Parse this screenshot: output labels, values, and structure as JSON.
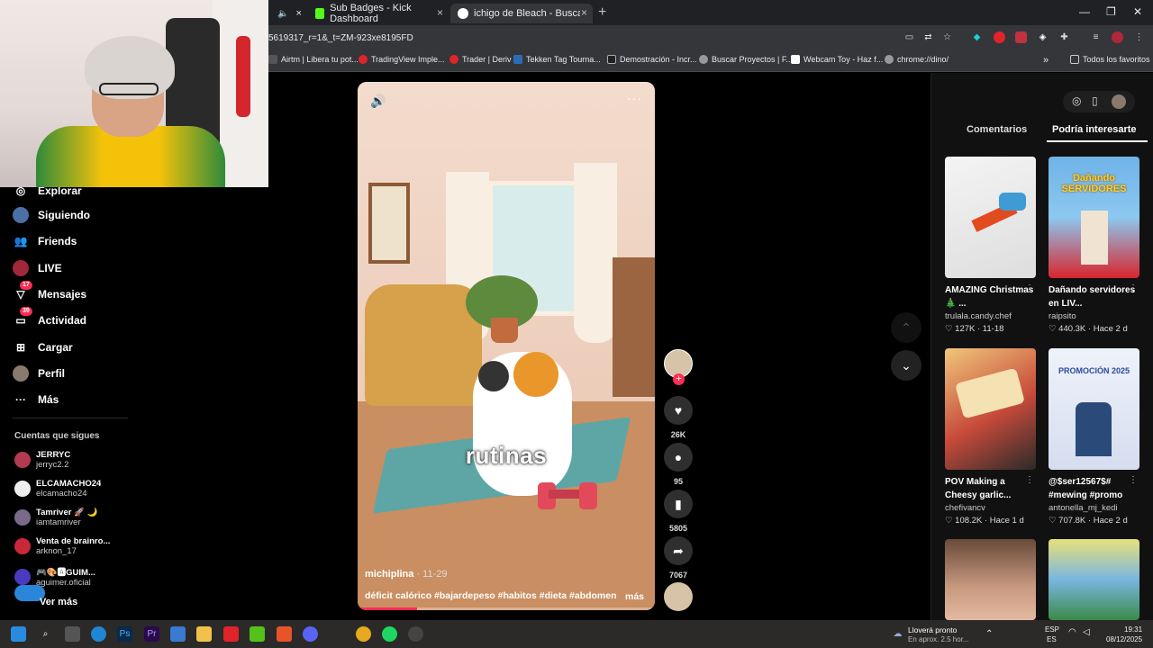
{
  "browser": {
    "tabs": [
      {
        "label": "Sub Badges - Kick Dashboard",
        "close": "×"
      },
      {
        "label": "ichigo de Bleach - Buscar con G",
        "close": "×"
      }
    ],
    "new_tab": "+",
    "first_tab_close": "×",
    "window_controls": [
      "—",
      "❐",
      "✕"
    ],
    "url": "5619317_r=1&_t=ZM-923xe8195FD",
    "bookmarks": [
      "Airtm | Libera tu pot...",
      "TradingView Imple...",
      "Trader | Deriv",
      "Tekken Tag Tourna...",
      "Demostración - Incr...",
      "Buscar Proyectos | F...",
      "Webcam Toy - Haz f...",
      "chrome://dino/"
    ],
    "bookmarks_more": "»",
    "all_bookmarks": "Todos los favoritos"
  },
  "sidebar": {
    "items": [
      {
        "label": "Explorar"
      },
      {
        "label": "Siguiendo"
      },
      {
        "label": "Friends"
      },
      {
        "label": "LIVE"
      },
      {
        "label": "Mensajes",
        "badge": "17"
      },
      {
        "label": "Actividad",
        "badge": "39"
      },
      {
        "label": "Cargar"
      },
      {
        "label": "Perfil"
      },
      {
        "label": "Más"
      }
    ],
    "following_title": "Cuentas que sigues",
    "following": [
      {
        "name": "JERRYC",
        "user": "jerryc2.2"
      },
      {
        "name": "ELCAMACHO24",
        "user": "elcamacho24"
      },
      {
        "name": "Tamriver 🚀 🌙",
        "user": "iamtamriver"
      },
      {
        "name": "Venta de brainro...",
        "user": "arknon_17"
      },
      {
        "name": "🎮🎨🅰GUIM...",
        "user": "aguimer.oficial"
      }
    ],
    "see_more": "Ver más"
  },
  "video": {
    "caption": "rutinas",
    "author": "michiplina",
    "date": " · 11-29",
    "description": "déficit calórico #bajardepeso #habitos #dieta #abdomen",
    "more": "más",
    "progress": 0.2
  },
  "actions": {
    "likes": "26K",
    "comments": "95",
    "saves": "5805",
    "shares": "7067"
  },
  "right_panel": {
    "tabs": [
      "Comentarios",
      "Podría interesarte"
    ],
    "active_tab": "Podría interesarte",
    "cards": [
      {
        "title": "AMAZING Christmas 🎄 ...",
        "author": "trulala.candy.chef",
        "likes": "127K",
        "date": "11-18"
      },
      {
        "title": "Dañando servidores en LIV...",
        "author": "raipsito",
        "likes": "440.3K",
        "date": "Hace 2 d"
      },
      {
        "title": "POV Making a Cheesy garlic...",
        "author": "chefivancv",
        "likes": "108.2K",
        "date": "Hace 1 d"
      },
      {
        "title": "@$ser12567$# #mewing #promo",
        "author": "antonella_mj_kedi",
        "likes": "707.8K",
        "date": "Hace 2 d"
      }
    ],
    "thumb_text": [
      "Dañando SERVIDORES",
      "PROMOCIÓN 2025"
    ]
  },
  "taskbar": {
    "weather_title": "Lloverá pronto",
    "weather_sub": "En aprox. 2.5 hor...",
    "lang": "ESP",
    "lang_sub": "ES",
    "time": "19:31",
    "date": "08/12/2025"
  }
}
